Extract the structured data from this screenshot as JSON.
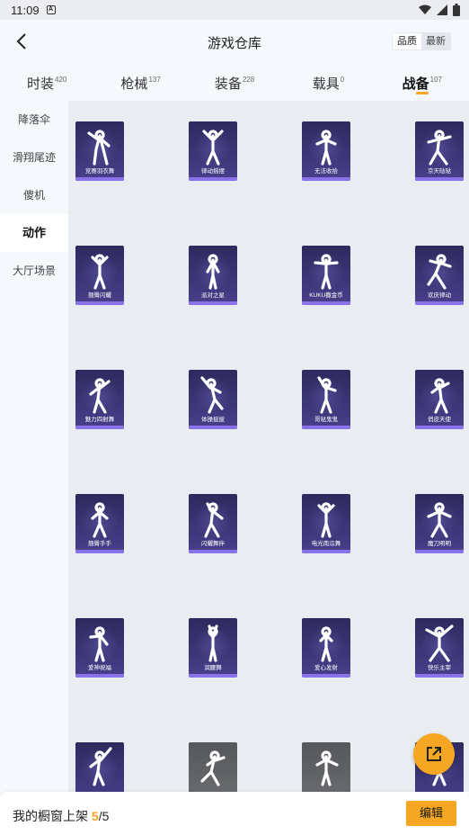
{
  "status_bar": {
    "time": "11:09",
    "notification_icon": "A"
  },
  "header": {
    "title": "游戏仓库",
    "sort_options": [
      {
        "label": "品质",
        "active": true
      },
      {
        "label": "最新",
        "active": false
      }
    ]
  },
  "tabs": [
    {
      "label": "时装",
      "count": "420",
      "active": false
    },
    {
      "label": "枪械",
      "count": "137",
      "active": false
    },
    {
      "label": "装备",
      "count": "228",
      "active": false
    },
    {
      "label": "载具",
      "count": "0",
      "active": false
    },
    {
      "label": "战备",
      "count": "107",
      "active": true
    }
  ],
  "sidebar": {
    "items": [
      {
        "label": "降落伞",
        "active": false
      },
      {
        "label": "滑翔尾迹",
        "active": false
      },
      {
        "label": "傻机",
        "active": false
      },
      {
        "label": "动作",
        "active": true
      },
      {
        "label": "大厅场景",
        "active": false
      }
    ]
  },
  "items": [
    {
      "name": "竞赛羽衣舞",
      "pose": 0,
      "locked": false
    },
    {
      "name": "律动摇摆",
      "pose": 1,
      "locked": false
    },
    {
      "name": "无法收拾",
      "pose": 2,
      "locked": false
    },
    {
      "name": "京天哒哒",
      "pose": 3,
      "locked": false
    },
    {
      "name": "翘臀闪耀",
      "pose": 4,
      "locked": false
    },
    {
      "name": "派对之星",
      "pose": 5,
      "locked": false
    },
    {
      "name": "KUKU撒金币",
      "pose": 6,
      "locked": false
    },
    {
      "name": "欢庆律动",
      "pose": 7,
      "locked": false
    },
    {
      "name": "魅力四射舞",
      "pose": 8,
      "locked": false
    },
    {
      "name": "体操挺拔",
      "pose": 9,
      "locked": false
    },
    {
      "name": "哥哒鬼鬼",
      "pose": 10,
      "locked": false
    },
    {
      "name": "俏皮天使",
      "pose": 11,
      "locked": false
    },
    {
      "name": "翘臀手手",
      "pose": 12,
      "locked": false
    },
    {
      "name": "闪耀舞拌",
      "pose": 13,
      "locked": false
    },
    {
      "name": "电光南瓜舞",
      "pose": 14,
      "locked": false
    },
    {
      "name": "魔刀明明",
      "pose": 15,
      "locked": false
    },
    {
      "name": "爱神祝福",
      "pose": 16,
      "locked": false
    },
    {
      "name": "润腰舞",
      "pose": 17,
      "locked": false
    },
    {
      "name": "爱心发射",
      "pose": 18,
      "locked": false
    },
    {
      "name": "快乐主宰",
      "pose": 19,
      "locked": false
    },
    {
      "name": "",
      "pose": 20,
      "locked": false
    },
    {
      "name": "",
      "pose": 21,
      "locked": true
    },
    {
      "name": "",
      "pose": 22,
      "locked": true
    },
    {
      "name": "",
      "pose": 23,
      "locked": false
    }
  ],
  "bottom_bar": {
    "label": "我的橱窗上架",
    "current": "5",
    "separator": "/",
    "total": "5",
    "edit_label": "编辑"
  },
  "colors": {
    "accent": "#f5a623",
    "card_top": "#2e2a5e",
    "card_stripe": "#8a72e8",
    "locked_card": "#6b6d72"
  },
  "icons": {
    "back": "chevron-left-icon",
    "share": "external-link-icon",
    "wifi": "wifi-icon",
    "signal": "signal-icon",
    "battery": "battery-icon"
  }
}
